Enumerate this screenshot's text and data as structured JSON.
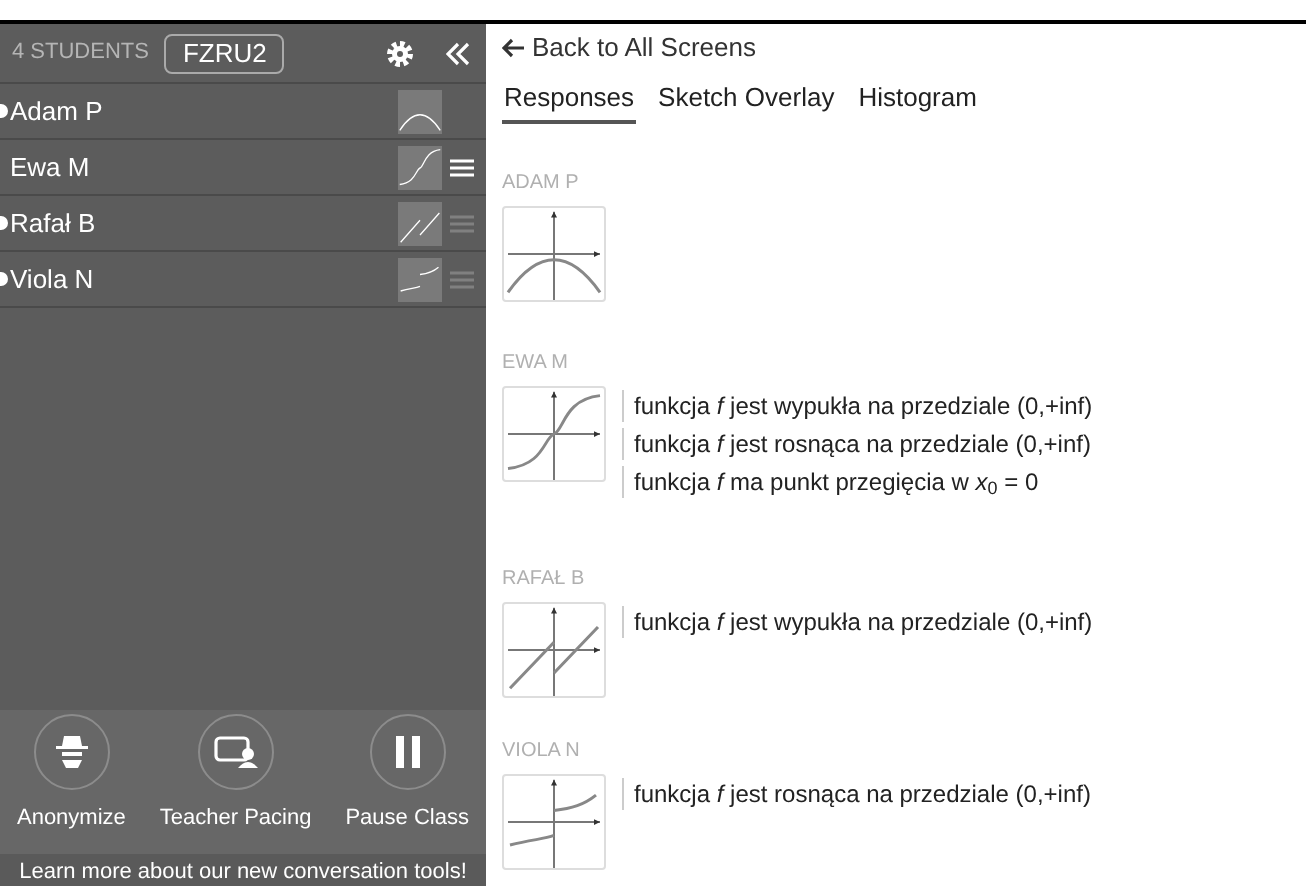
{
  "sidebar": {
    "student_count": "4 STUDENTS",
    "class_code": "FZRU2",
    "students": [
      {
        "name": "Adam P",
        "online": true,
        "kind": "parabola",
        "answered": false,
        "highlighted": false
      },
      {
        "name": "Ewa M",
        "online": false,
        "kind": "s-curve",
        "answered": true,
        "highlighted": true
      },
      {
        "name": "Rafał B",
        "online": true,
        "kind": "jump-lines",
        "answered": true,
        "highlighted": false
      },
      {
        "name": "Viola N",
        "online": true,
        "kind": "step-curve",
        "answered": true,
        "highlighted": false
      }
    ],
    "controls": [
      {
        "kind": "anonymize",
        "label": "Anonymize"
      },
      {
        "kind": "pacing",
        "label": "Teacher Pacing"
      },
      {
        "kind": "pause",
        "label": "Pause Class"
      }
    ],
    "footer_link": "Learn more about our new conversation tools!"
  },
  "main": {
    "back_link": "Back to All Screens",
    "tabs": [
      {
        "label": "Responses",
        "selected": true
      },
      {
        "label": "Sketch Overlay",
        "selected": false
      },
      {
        "label": "Histogram",
        "selected": false
      }
    ],
    "responses": [
      {
        "name": "ADAM P",
        "kind": "parabola"
      },
      {
        "name": "EWA M",
        "kind": "s-curve",
        "statements": [
          "funkcja *f* jest wypukła na przedziale  (0,+inf)",
          "funkcja *f* jest rosnąca na przedziale (0,+inf)",
          "funkcja *f* ma punkt przegięcia w *x*$_{0}$ = 0"
        ]
      },
      {
        "name": "RAFAŁ B",
        "kind": "jump-lines",
        "statements": [
          "funkcja *f* jest wypukła na przedziale  (0,+inf)"
        ]
      },
      {
        "name": "VIOLA N",
        "kind": "step-curve",
        "statements": [
          "funkcja *f* jest rosnąca na przedziale (0,+inf)"
        ]
      }
    ]
  }
}
